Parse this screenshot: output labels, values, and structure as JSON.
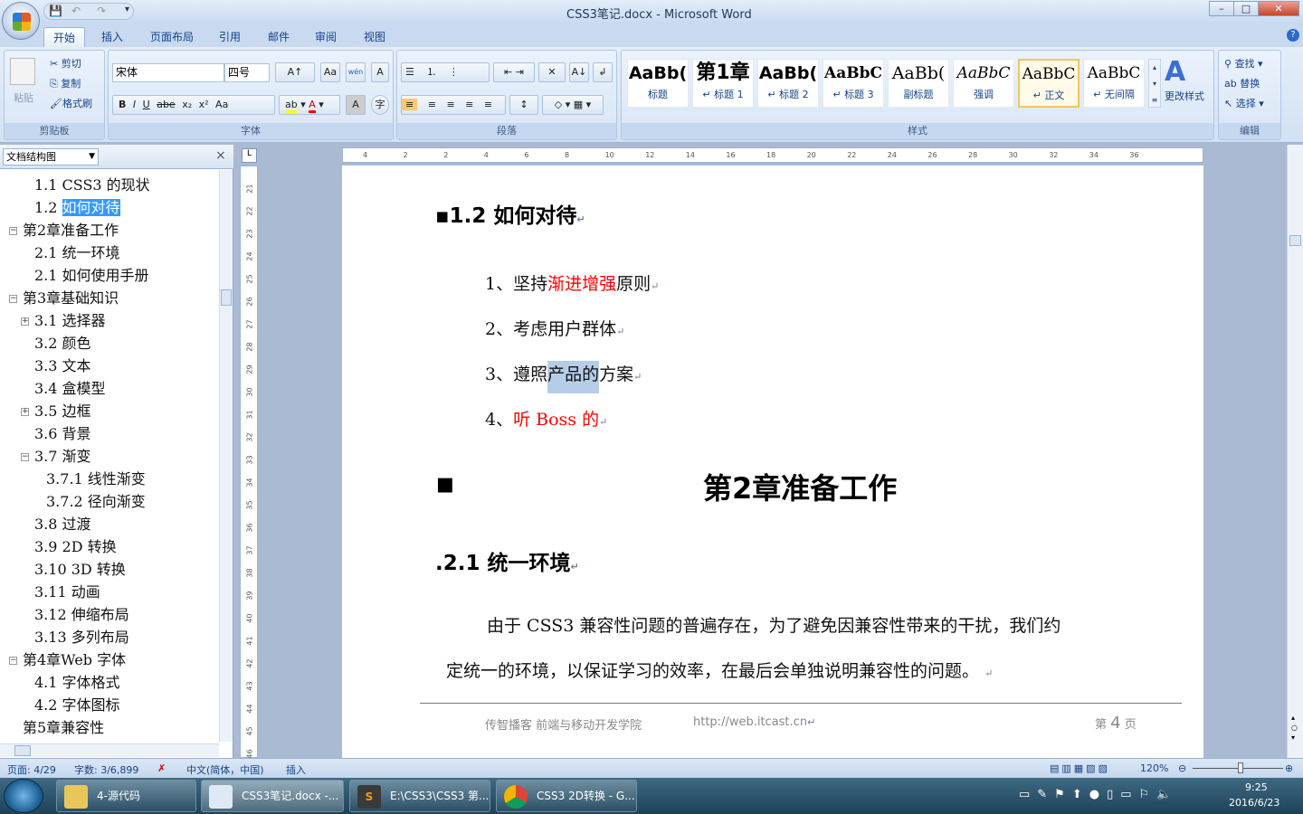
{
  "window": {
    "title": "CSS3笔记.docx - Microsoft Word",
    "min": "–",
    "max": "□",
    "close": "✕"
  },
  "tabs": [
    "开始",
    "插入",
    "页面布局",
    "引用",
    "邮件",
    "审阅",
    "视图"
  ],
  "ribbon": {
    "clipboard": {
      "label": "剪贴板",
      "paste": "粘贴",
      "cut": "剪切",
      "copy": "复制",
      "format_painter": "格式刷"
    },
    "font": {
      "label": "字体",
      "font_name": "宋体",
      "font_size": "四号",
      "grow": "A↑",
      "shrink": "A↓",
      "clear": "Aa",
      "wen": "wén",
      "charborder": "A",
      "bold": "B",
      "italic": "I",
      "underline": "U",
      "strike": "abe",
      "sub": "x₂",
      "sup": "x²",
      "case": "Aa",
      "highlight": "ab",
      "color": "A",
      "shade": "A",
      "enclose": "字"
    },
    "paragraph": {
      "label": "段落",
      "bullets": "☰",
      "numbering": "⒈",
      "multilevel": "⋮",
      "dec_indent": "⇤",
      "inc_indent": "⇥",
      "cn_layout": "✕",
      "sort": "A↓",
      "show_marks": "↲",
      "align_left": "≡",
      "center": "≡",
      "align_right": "≡",
      "justify": "≡",
      "distribute": "≡",
      "line_spacing": "↕",
      "shading": "◇",
      "borders": "▦"
    },
    "styles": {
      "label": "样式",
      "items": [
        {
          "sample": "AaBb(",
          "name": "标题"
        },
        {
          "sample": "第1章",
          "name": "↵ 标题 1"
        },
        {
          "sample": "AaBb(",
          "name": "↵ 标题 2"
        },
        {
          "sample": "AaBbC",
          "name": "↵ 标题 3"
        },
        {
          "sample": "AaBb(",
          "name": "副标题"
        },
        {
          "sample": "AaBbC",
          "name": "强调"
        },
        {
          "sample": "AaBbC",
          "name": "↵ 正文"
        },
        {
          "sample": "AaBbC",
          "name": "↵ 无间隔"
        }
      ],
      "change": "更改样式",
      "selected": "↵ 正文"
    },
    "editing": {
      "label": "编辑",
      "find": "查找",
      "replace": "替换",
      "select": "选择"
    }
  },
  "nav": {
    "mode": "文档结构图",
    "close": "×",
    "items": [
      {
        "text": "1.1 CSS3 的现状",
        "level": 2
      },
      {
        "pre": "1.2 ",
        "hl": "如何对待",
        "level": 2
      },
      {
        "text": "第2章准备工作",
        "level": 1,
        "exp": "⊟"
      },
      {
        "text": "2.1 统一环境",
        "level": 2
      },
      {
        "text": "2.1 如何使用手册",
        "level": 2
      },
      {
        "text": "第3章基础知识",
        "level": 1,
        "exp": "⊟"
      },
      {
        "text": "3.1 选择器",
        "level": 2,
        "exp": "⊞"
      },
      {
        "text": "3.2 颜色",
        "level": 2
      },
      {
        "text": "3.3 文本",
        "level": 2
      },
      {
        "text": "3.4 盒模型",
        "level": 2
      },
      {
        "text": "3.5 边框",
        "level": 2,
        "exp": "⊞"
      },
      {
        "text": "3.6 背景",
        "level": 2
      },
      {
        "text": "3.7 渐变",
        "level": 2,
        "exp": "⊟"
      },
      {
        "text": "3.7.1 线性渐变",
        "level": 3
      },
      {
        "text": "3.7.2 径向渐变",
        "level": 3
      },
      {
        "text": "3.8 过渡",
        "level": 2
      },
      {
        "text": "3.9 2D 转换",
        "level": 2
      },
      {
        "text": "3.10 3D 转换",
        "level": 2
      },
      {
        "text": "3.11 动画",
        "level": 2
      },
      {
        "text": "3.12 伸缩布局",
        "level": 2
      },
      {
        "text": "3.13 多列布局",
        "level": 2
      },
      {
        "text": "第4章Web 字体",
        "level": 1,
        "exp": "⊟"
      },
      {
        "text": "4.1 字体格式",
        "level": 2
      },
      {
        "text": "4.2 字体图标",
        "level": 2
      },
      {
        "text": "第5章兼容性",
        "level": 1
      }
    ]
  },
  "ruler": {
    "h": [
      "4",
      "2",
      "2",
      "4",
      "6",
      "8",
      "10",
      "12",
      "14",
      "16",
      "18",
      "20",
      "22",
      "24",
      "26",
      "28",
      "30",
      "32",
      "34",
      "36"
    ],
    "v": [
      "21",
      "22",
      "23",
      "24",
      "25",
      "26",
      "27",
      "28",
      "29",
      "30",
      "31",
      "32",
      "33",
      "34",
      "35",
      "36",
      "37",
      "38",
      "39",
      "40",
      "41",
      "42",
      "43",
      "44",
      "45",
      "46",
      "47"
    ]
  },
  "doc": {
    "h2a": "1.2  如何对待",
    "list": [
      {
        "num": "1、",
        "parts": [
          {
            "t": "坚持"
          },
          {
            "t": "渐进增强",
            "red": true
          },
          {
            "t": "原则"
          }
        ]
      },
      {
        "num": "2、",
        "parts": [
          {
            "t": "考虑用户群体"
          }
        ]
      },
      {
        "num": "3、",
        "parts": [
          {
            "t": "遵照"
          },
          {
            "t": "产品的",
            "sel": true
          },
          {
            "t": "方案"
          }
        ]
      },
      {
        "num": "4、",
        "parts": [
          {
            "t": "听 Boss 的",
            "red": true
          }
        ]
      }
    ],
    "h1": "第2章准备工作",
    "h2b": "2.1  统一环境",
    "para1": "由于 CSS3 兼容性问题的普遍存在，为了避免因兼容性带来的干扰，我们约",
    "para2": "定统一的环境，以保证学习的效率，在最后会单独说明兼容性的问题。",
    "para_mark": "↵",
    "footer": {
      "left": "传智播客  前端与移动开发学院",
      "url": "http://web.itcast.cn",
      "page_pre": "第",
      "page": "4",
      "page_post": "页"
    }
  },
  "status": {
    "page": "页面: 4/29",
    "words": "字数: 3/6,899",
    "lang": "中文(简体，中国)",
    "mode": "插入",
    "zoom": "120%",
    "zoom_level": 120
  },
  "taskbar": {
    "items": [
      "4-源代码",
      "CSS3笔记.docx -...",
      "E:\\CSS3\\CSS3 第...",
      "CSS3 2D转换 - G..."
    ],
    "time": "9:25",
    "date": "2016/6/23"
  },
  "colors": {
    "accent_red": "#ff0000",
    "selection": "#3399ff",
    "doc_selection": "#b6cde8"
  }
}
